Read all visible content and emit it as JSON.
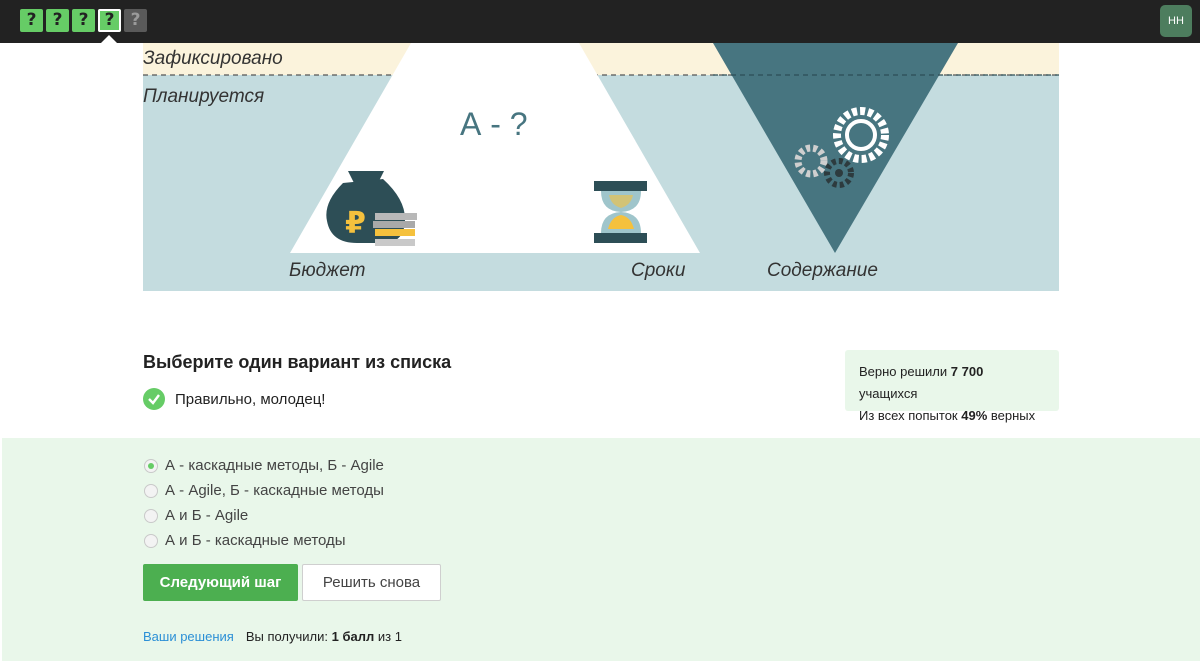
{
  "topbar": {
    "steps": [
      "?",
      "?",
      "?",
      "?",
      "?"
    ],
    "avatar_initials": "НН"
  },
  "figure": {
    "label_fixed": "Зафиксировано",
    "label_planned": "Планируется",
    "question": "А - ?",
    "label_budget": "Бюджет",
    "label_time": "Сроки",
    "label_content": "Содержание",
    "icons": [
      "money-bag-icon",
      "hourglass-icon",
      "gears-icon"
    ],
    "colors": {
      "fixed_bg": "#fbf3dc",
      "planned_bg": "#c4dcdf",
      "triangle_dark": "#477580",
      "triangle_light": "#ffffff"
    }
  },
  "question": {
    "title": "Выберите один вариант из списка",
    "status": "Правильно, молодец!"
  },
  "stats": {
    "line1_prefix": "Верно решили ",
    "line1_count": "7 700",
    "line1_suffix": " учащихся",
    "line2_prefix": "Из всех попыток ",
    "line2_percent": "49%",
    "line2_suffix": " верных"
  },
  "options": [
    {
      "label": "А - каскадные методы, Б - Agile",
      "checked": true
    },
    {
      "label": "А - Agile, Б - каскадные методы",
      "checked": false
    },
    {
      "label": "А и Б - Agile",
      "checked": false
    },
    {
      "label": "А и Б - каскадные методы",
      "checked": false
    }
  ],
  "buttons": {
    "next": "Следующий шаг",
    "retry": "Решить снова"
  },
  "footer": {
    "solutions_link": "Ваши решения",
    "score_prefix": "Вы получили: ",
    "score_value": "1 балл",
    "score_suffix": " из 1"
  },
  "accent": "#66cc66"
}
